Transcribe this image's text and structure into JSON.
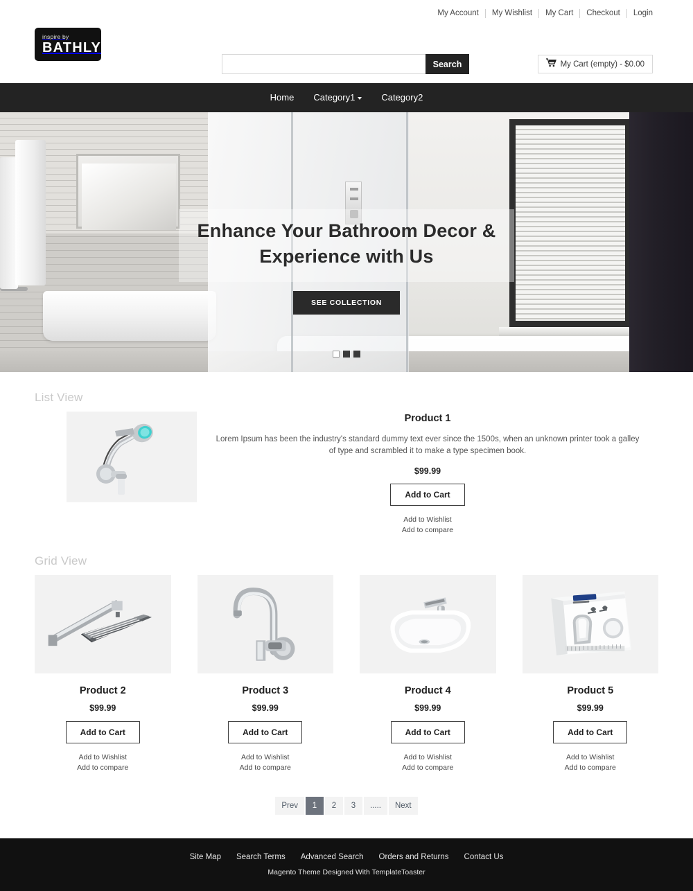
{
  "topbar": {
    "links": [
      {
        "label": "My Account",
        "name": "my-account"
      },
      {
        "label": "My Wishlist",
        "name": "my-wishlist"
      },
      {
        "label": "My Cart",
        "name": "my-cart"
      },
      {
        "label": "Checkout",
        "name": "checkout"
      },
      {
        "label": "Login",
        "name": "login"
      }
    ]
  },
  "header": {
    "logo_sub": "inspire by",
    "logo_main": "BATHLY",
    "search": {
      "value": "",
      "placeholder": "",
      "button_label": "Search"
    },
    "cart": {
      "label": "My Cart (empty) - $0.00",
      "icon": "shopping-cart-icon"
    }
  },
  "nav": {
    "items": [
      {
        "label": "Home",
        "has_dropdown": false
      },
      {
        "label": "Category1",
        "has_dropdown": true
      },
      {
        "label": "Category2",
        "has_dropdown": false
      }
    ]
  },
  "hero": {
    "title_line1": "Enhance Your Bathroom Decor &",
    "title_line2": "Experience with Us",
    "button_label": "SEE COLLECTION",
    "slides": 3,
    "active_slide": 1
  },
  "list_section": {
    "heading": "List View",
    "product": {
      "name": "Product 1",
      "description": "Lorem Ipsum has been the industry's standard dummy text ever since the 1500s, when an unknown printer took a galley of type and scrambled it to make a type specimen book.",
      "price": "$99.99",
      "add_to_cart": "Add to Cart",
      "wishlist": "Add to Wishlist",
      "compare": "Add to compare",
      "image": "handheld-shower-head"
    }
  },
  "grid_section": {
    "heading": "Grid View",
    "products": [
      {
        "name": "Product 2",
        "price": "$99.99",
        "add_to_cart": "Add to Cart",
        "wishlist": "Add to Wishlist",
        "compare": "Add to compare",
        "image": "square-rain-shower-head"
      },
      {
        "name": "Product 3",
        "price": "$99.99",
        "add_to_cart": "Add to Cart",
        "wishlist": "Add to Wishlist",
        "compare": "Add to compare",
        "image": "gooseneck-wall-faucet"
      },
      {
        "name": "Product 4",
        "price": "$99.99",
        "add_to_cart": "Add to Cart",
        "wishlist": "Add to Wishlist",
        "compare": "Add to compare",
        "image": "ceramic-washbasin-with-faucet"
      },
      {
        "name": "Product 5",
        "price": "$99.99",
        "add_to_cart": "Add to Cart",
        "wishlist": "Add to Wishlist",
        "compare": "Add to compare",
        "image": "wall-hand-dryer"
      }
    ]
  },
  "pagination": {
    "prev": "Prev",
    "next": "Next",
    "pages": [
      "1",
      "2",
      "3",
      "....."
    ],
    "active": "1"
  },
  "footer": {
    "links": [
      "Site Map",
      "Search Terms",
      "Advanced Search",
      "Orders and Returns",
      "Contact Us"
    ],
    "copyright": "Magento Theme Designed With TemplateToaster"
  },
  "colors": {
    "dark": "#232323",
    "nav_bg": "#232323",
    "footer_bg": "#111111",
    "thumb_bg": "#f2f2f2",
    "muted_heading": "#c9c9c9",
    "page_active": "#6d737d"
  }
}
